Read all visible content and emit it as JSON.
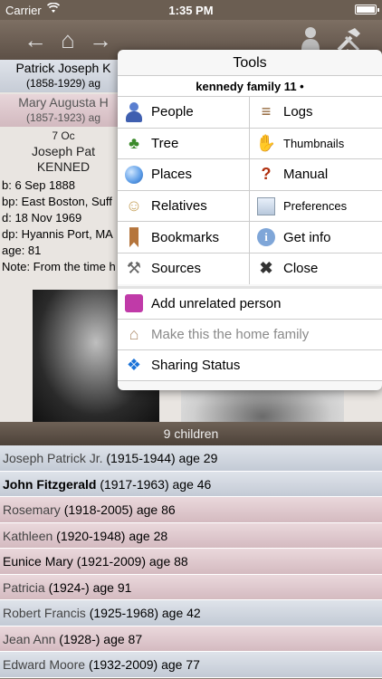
{
  "status_bar": {
    "carrier": "Carrier",
    "time": "1:35 PM"
  },
  "background": {
    "father_name": "Patrick Joseph K",
    "father_years": "(1858-1929) ag",
    "mother_name": "Mary Augusta H",
    "mother_years": "(1857-1923) ag",
    "person_date": "7 Oc",
    "person_name": "Joseph Pat",
    "person_surname": "KENNED",
    "facts": [
      "b: 6 Sep 1888",
      "bp: East Boston, Suff",
      "d: 18 Nov 1969",
      "dp: Hyannis Port, MA",
      "age: 81",
      "Note: From the time h"
    ]
  },
  "children_header": "9 children",
  "children": [
    {
      "name": "Joseph Patrick Jr.",
      "detail": "(1915-1944) age 29",
      "sex": "male",
      "style": "normal"
    },
    {
      "name": "John Fitzgerald",
      "detail": "(1917-1963) age 46",
      "sex": "male",
      "style": "bold"
    },
    {
      "name": "Rosemary",
      "detail": "(1918-2005) age 86",
      "sex": "female",
      "style": "normal"
    },
    {
      "name": "Kathleen",
      "detail": "(1920-1948) age 28",
      "sex": "female",
      "style": "normal"
    },
    {
      "name": "Eunice Mary",
      "detail": "(1921-2009) age 88",
      "sex": "female",
      "style": "dark"
    },
    {
      "name": "Patricia",
      "detail": "(1924-) age 91",
      "sex": "female",
      "style": "normal"
    },
    {
      "name": "Robert Francis",
      "detail": "(1925-1968) age 42",
      "sex": "male",
      "style": "normal"
    },
    {
      "name": "Jean Ann",
      "detail": "(1928-) age 87",
      "sex": "female",
      "style": "normal"
    },
    {
      "name": "Edward Moore",
      "detail": "(1932-2009) age 77",
      "sex": "male",
      "style": "normal"
    }
  ],
  "tools": {
    "title": "Tools",
    "family_file": "kennedy family 11",
    "left": [
      {
        "label": "People",
        "icon": "people-icon"
      },
      {
        "label": "Tree",
        "icon": "tree-icon"
      },
      {
        "label": "Places",
        "icon": "globe-icon"
      },
      {
        "label": "Relatives",
        "icon": "relatives-icon"
      },
      {
        "label": "Bookmarks",
        "icon": "bookmark-icon"
      },
      {
        "label": "Sources",
        "icon": "shovel-icon"
      }
    ],
    "right": [
      {
        "label": "Logs",
        "icon": "logs-icon"
      },
      {
        "label": "Thumbnails",
        "icon": "thumbs-up-icon"
      },
      {
        "label": "Manual",
        "icon": "question-icon"
      },
      {
        "label": "Preferences",
        "icon": "preferences-icon"
      },
      {
        "label": "Get info",
        "icon": "info-icon"
      },
      {
        "label": "Close",
        "icon": "close-icon"
      }
    ],
    "add_unrelated": "Add unrelated person",
    "make_home": "Make this the home family",
    "sharing": "Sharing Status"
  }
}
